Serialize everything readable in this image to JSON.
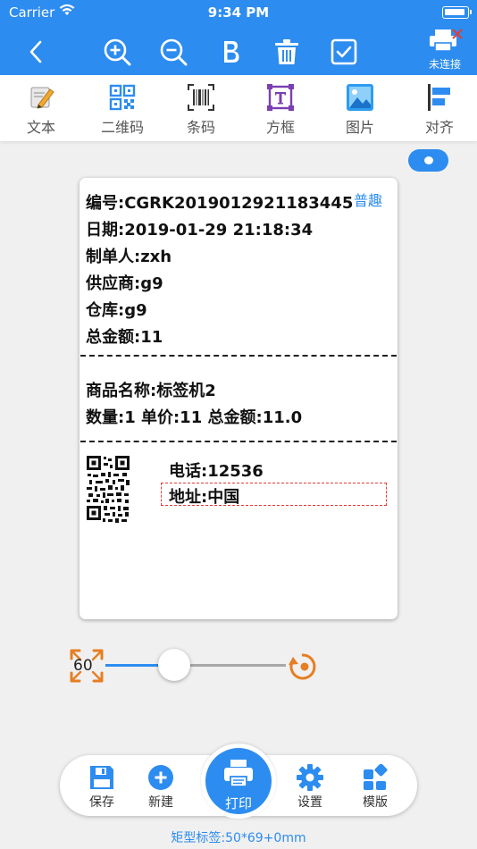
{
  "status_bar": {
    "carrier": "Carrier",
    "time": "9:34 PM"
  },
  "nav": {
    "printer_status": "未连接",
    "icons": [
      "back-icon",
      "zoom-in-icon",
      "zoom-out-icon",
      "bold-icon",
      "trash-icon",
      "checkbox-icon",
      "printer-disconnected-icon"
    ]
  },
  "toolbar": {
    "items": [
      {
        "label": "文本",
        "icon": "pencil-icon"
      },
      {
        "label": "二维码",
        "icon": "qr-code-icon"
      },
      {
        "label": "条码",
        "icon": "barcode-icon"
      },
      {
        "label": "方框",
        "icon": "text-frame-icon"
      },
      {
        "label": "图片",
        "icon": "image-icon"
      },
      {
        "label": "对齐",
        "icon": "align-icon"
      }
    ]
  },
  "label": {
    "badge": "普趣",
    "header_lines": [
      "编号:CGRK2019012921183445",
      "日期:2019-01-29 21:18:34",
      "制单人:zxh",
      "供应商:g9",
      "仓库:g9",
      "总金额:11"
    ],
    "item_lines": [
      "商品名称:标签机2",
      "数量:1  单价:11  总金额:11.0"
    ],
    "phone": "电话:12536",
    "address": "地址:中国"
  },
  "zoom": {
    "value": "60",
    "slider_fraction": 0.38
  },
  "bottom_bar": {
    "save": "保存",
    "new": "新建",
    "print": "打印",
    "settings": "设置",
    "template": "模版"
  },
  "footnote": "矩型标签:50*69+0mm",
  "colors": {
    "primary": "#2d8cf0",
    "orange": "#e67e22",
    "purple": "#7b3fb0",
    "danger": "#e53935"
  }
}
